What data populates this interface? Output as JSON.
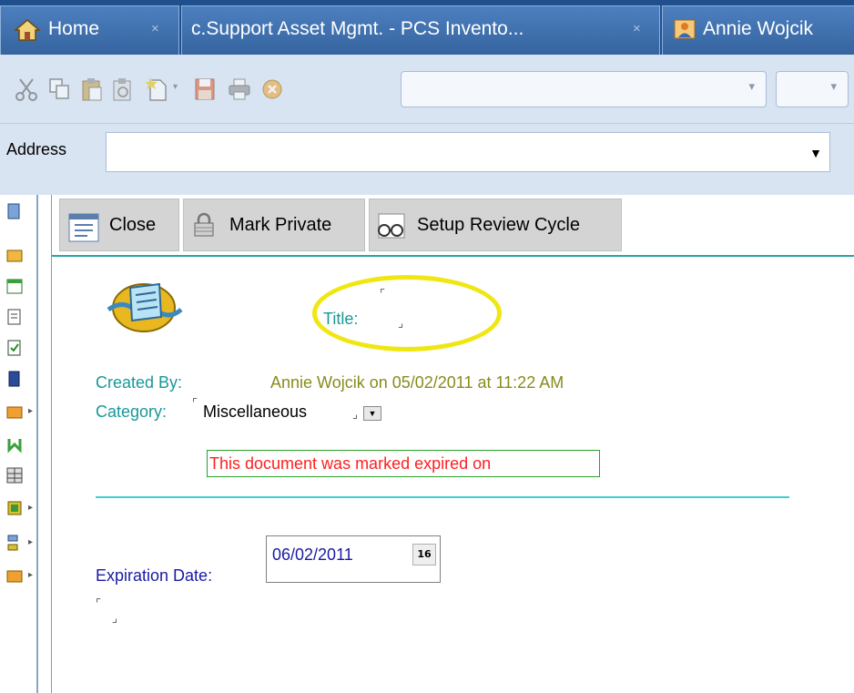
{
  "tabs": [
    {
      "label": "Home",
      "icon": "home-icon"
    },
    {
      "label": "c.Support Asset Mgmt. - PCS Invento...",
      "icon": ""
    },
    {
      "label": "Annie Wojcik",
      "icon": "person-icon"
    }
  ],
  "tab_close_glyph": "×",
  "address": {
    "label": "Address",
    "value": "",
    "dropdown_glyph": "▼"
  },
  "toolbar": {
    "combo_arrow": "▾"
  },
  "actions": {
    "close_label": "Close",
    "mark_private_label": "Mark Private",
    "setup_review_label": "Setup Review Cycle"
  },
  "form": {
    "title_label": "Title:",
    "title_value": "",
    "created_by_label": "Created By:",
    "created_by_value": "Annie Wojcik on 05/02/2011 at 11:22 AM",
    "category_label": "Category:",
    "category_value": "Miscellaneous",
    "expired_message": "This document was marked expired on",
    "expiration_label": "Expiration Date:",
    "expiration_value": "06/02/2011",
    "calendar_glyph": "16",
    "bracket_open": "⌜",
    "bracket_close": "⌟"
  },
  "colors": {
    "tab_bg": "#35649f",
    "teal_label": "#1a9797",
    "olive_value": "#8a8a1c",
    "expired_red": "#ff2020",
    "highlight_yellow": "#f0e612",
    "divider_cyan": "#3fcfd0",
    "expiration_blue": "#1a1aa6"
  }
}
